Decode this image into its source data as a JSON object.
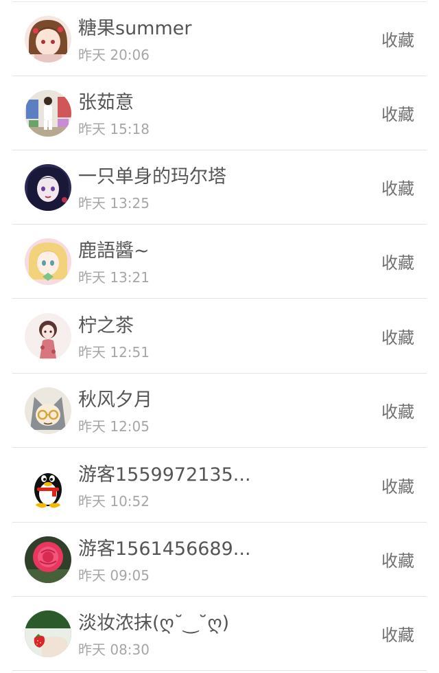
{
  "items": [
    {
      "name": "糖果summer",
      "time": "昨天 20:06",
      "action": "收藏",
      "avatar": "anime-girl-red-avatar"
    },
    {
      "name": "张茹意",
      "time": "昨天 15:18",
      "action": "收藏",
      "avatar": "stage-photo-avatar"
    },
    {
      "name": "一只单身的玛尔塔",
      "time": "昨天 13:25",
      "action": "收藏",
      "avatar": "dark-anime-avatar"
    },
    {
      "name": "鹿語醬~",
      "time": "昨天 13:21",
      "action": "收藏",
      "avatar": "blonde-anime-avatar"
    },
    {
      "name": "柠之茶",
      "time": "昨天 12:51",
      "action": "收藏",
      "avatar": "chibi-girl-avatar"
    },
    {
      "name": "秋风夕月",
      "time": "昨天 12:05",
      "action": "收藏",
      "avatar": "glasses-cat-avatar"
    },
    {
      "name": "游客1559972135...",
      "time": "昨天 10:52",
      "action": "收藏",
      "avatar": "qq-penguin-avatar"
    },
    {
      "name": "游客1561456689...",
      "time": "昨天 09:05",
      "action": "收藏",
      "avatar": "rose-avatar"
    },
    {
      "name": "淡妆浓抹(ღ˘‿˘ღ)",
      "time": "昨天 08:30",
      "action": "收藏",
      "avatar": "strawberry-hand-avatar"
    }
  ],
  "colors": {
    "name_text": "#555555",
    "time_text": "#a6a6a6",
    "action_text": "#707070",
    "divider": "#e3e3e3"
  }
}
